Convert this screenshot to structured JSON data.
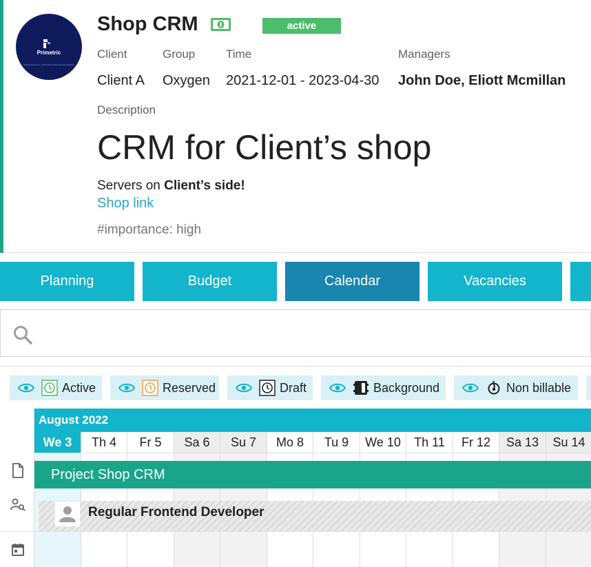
{
  "project": {
    "logo_name": "Primetric",
    "logo_tagline": "Project, Resource, and Financial Management software",
    "title": "Shop CRM",
    "status": "active",
    "fields": [
      {
        "label": "Client",
        "value": "Client A"
      },
      {
        "label": "Group",
        "value": "Oxygen"
      },
      {
        "label": "Time",
        "value": "2021-12-01 - 2023-04-30"
      },
      {
        "label": "Managers",
        "value": "John Doe, Eliott Mcmillan"
      }
    ],
    "description_label": "Description",
    "description_title": "CRM for Client’s shop",
    "description_text_prefix": "Servers on ",
    "description_text_bold": "Client’s side!",
    "link_text": "Shop link",
    "hashtag": "#importance: high"
  },
  "tabs": [
    {
      "label": "Planning",
      "active": false
    },
    {
      "label": "Budget",
      "active": false
    },
    {
      "label": "Calendar",
      "active": true
    },
    {
      "label": "Vacancies",
      "active": false
    },
    {
      "label": "",
      "active": false
    }
  ],
  "search": {
    "placeholder": "",
    "value": ""
  },
  "filters": [
    {
      "label": "Active",
      "icon": "clock-icon",
      "color": "#4cbd6b"
    },
    {
      "label": "Reserved",
      "icon": "clock-icon",
      "color": "#f39c4a"
    },
    {
      "label": "Draft",
      "icon": "clock-icon",
      "color": "#212121"
    },
    {
      "label": "Background",
      "icon": "background-icon",
      "color": "#212121"
    },
    {
      "label": "Non billable",
      "icon": "non-billable-icon",
      "color": "#212121"
    }
  ],
  "calendar": {
    "month": "August 2022",
    "days": [
      {
        "label": "We 3",
        "today": true,
        "weekend": false
      },
      {
        "label": "Th 4",
        "today": false,
        "weekend": false
      },
      {
        "label": "Fr 5",
        "today": false,
        "weekend": false
      },
      {
        "label": "Sa 6",
        "today": false,
        "weekend": true
      },
      {
        "label": "Su 7",
        "today": false,
        "weekend": true
      },
      {
        "label": "Mo 8",
        "today": false,
        "weekend": false
      },
      {
        "label": "Tu 9",
        "today": false,
        "weekend": false
      },
      {
        "label": "We 10",
        "today": false,
        "weekend": false
      },
      {
        "label": "Th 11",
        "today": false,
        "weekend": false
      },
      {
        "label": "Fr 12",
        "today": false,
        "weekend": false
      },
      {
        "label": "Sa 13",
        "today": false,
        "weekend": true
      },
      {
        "label": "Su 14",
        "today": false,
        "weekend": true
      }
    ],
    "project_row": "Project Shop CRM",
    "role_row": "Regular Frontend Developer"
  },
  "colors": {
    "accent": "#13b5cc",
    "accent_dark": "#1886ae",
    "project_green": "#1aa58a",
    "status_green": "#4cbd6b",
    "link": "#2aa7c7"
  }
}
